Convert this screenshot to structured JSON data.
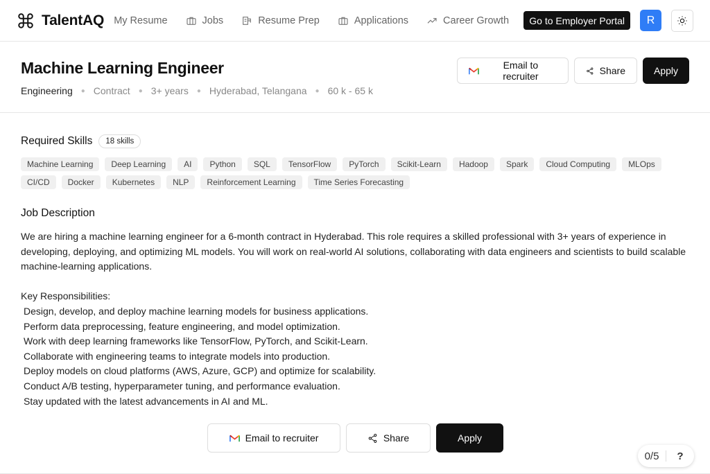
{
  "nav": {
    "logo_text": "TalentAQ",
    "links": [
      {
        "label": "My Resume",
        "icon": "none"
      },
      {
        "label": "Jobs",
        "icon": "briefcase-icon"
      },
      {
        "label": "Resume Prep",
        "icon": "document-check-icon"
      },
      {
        "label": "Applications",
        "icon": "briefcase-icon"
      },
      {
        "label": "Career Growth",
        "icon": "trend-up-icon"
      }
    ],
    "employer_portal": "Go to Employer Portal",
    "avatar_initial": "R",
    "theme_icon": "sun-icon"
  },
  "job": {
    "title": "Machine Learning Engineer",
    "department": "Engineering",
    "type": "Contract",
    "experience": "3+ years",
    "location": "Hyderabad, Telangana",
    "salary": "60 k - 65 k"
  },
  "actions": {
    "email": "Email to recruiter",
    "share": "Share",
    "apply": "Apply"
  },
  "skills": {
    "title": "Required Skills",
    "count": "18 skills",
    "items": [
      "Machine Learning",
      "Deep Learning",
      "AI",
      "Python",
      "SQL",
      "TensorFlow",
      "PyTorch",
      "Scikit-Learn",
      "Hadoop",
      "Spark",
      "Cloud Computing",
      "MLOps",
      "CI/CD",
      "Docker",
      "Kubernetes",
      "NLP",
      "Reinforcement Learning",
      "Time Series Forecasting"
    ]
  },
  "description": {
    "title": "Job Description",
    "intro": "We are hiring a machine learning engineer for a 6-month contract in Hyderabad. This role requires a skilled professional with 3+ years of experience in developing, deploying, and optimizing ML models. You will work on real-world AI solutions, collaborating with data engineers and scientists to build scalable machine-learning applications.",
    "resp_heading": "Key Responsibilities:",
    "responsibilities": [
      "Design, develop, and deploy machine learning models for business applications.",
      "Perform data preprocessing, feature engineering, and model optimization.",
      "Work with deep learning frameworks like TensorFlow, PyTorch, and Scikit-Learn.",
      "Collaborate with engineering teams to integrate models into production.",
      "Deploy models on cloud platforms (AWS, Azure, GCP) and optimize for scalability.",
      "Conduct A/B testing, hyperparameter tuning, and performance evaluation.",
      "Stay updated with the latest advancements in AI and ML."
    ]
  },
  "counter": {
    "value": "0/5",
    "help": "?"
  },
  "colors": {
    "accent": "#2f7df6",
    "dark": "#111111"
  }
}
